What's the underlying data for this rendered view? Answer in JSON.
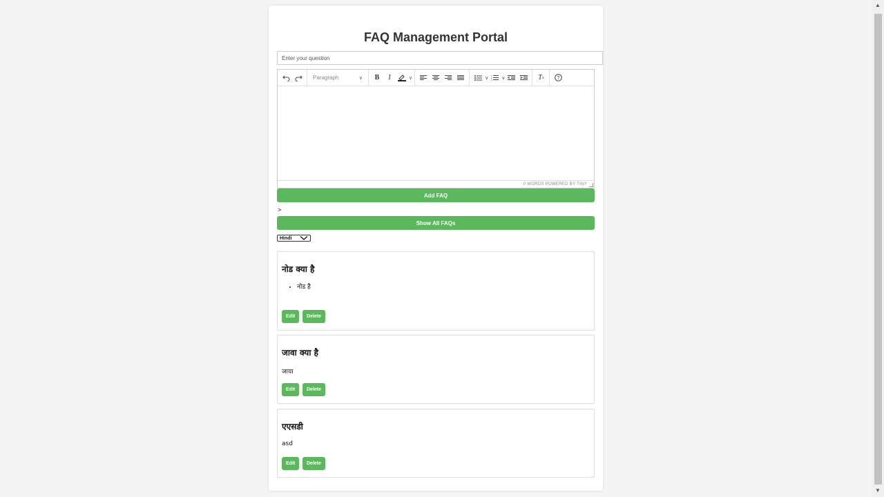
{
  "title": "FAQ Management Portal",
  "question_input": {
    "placeholder": "Enter your question",
    "value": ""
  },
  "editor": {
    "block_format": "Paragraph",
    "status": "0 WORDS  POWERED BY TINY",
    "toolbar_icons": [
      "undo-icon",
      "redo-icon",
      "bold-icon",
      "italic-icon",
      "text-color-icon",
      "align-left-icon",
      "align-center-icon",
      "align-right-icon",
      "align-justify-icon",
      "bullet-list-icon",
      "numbered-list-icon",
      "outdent-icon",
      "indent-icon",
      "clear-formatting-icon",
      "help-icon"
    ]
  },
  "add_button": "Add FAQ",
  "stray_text": ">",
  "show_all_button": "Show All FAQs",
  "language_select": {
    "selected": "Hindi"
  },
  "faqs": [
    {
      "question": "नोड क्या है",
      "answer_items": [
        "नोड है"
      ],
      "edit": "Edit",
      "delete": "Delete"
    },
    {
      "question": "जावा क्या है",
      "answer": "जाया",
      "edit": "Edit",
      "delete": "Delete"
    },
    {
      "question": "एएसडी",
      "answer": "asd",
      "edit": "Edit",
      "delete": "Delete"
    }
  ],
  "colors": {
    "accent": "#5cb85c",
    "background": "#f4f4f4",
    "card": "#ffffff"
  }
}
